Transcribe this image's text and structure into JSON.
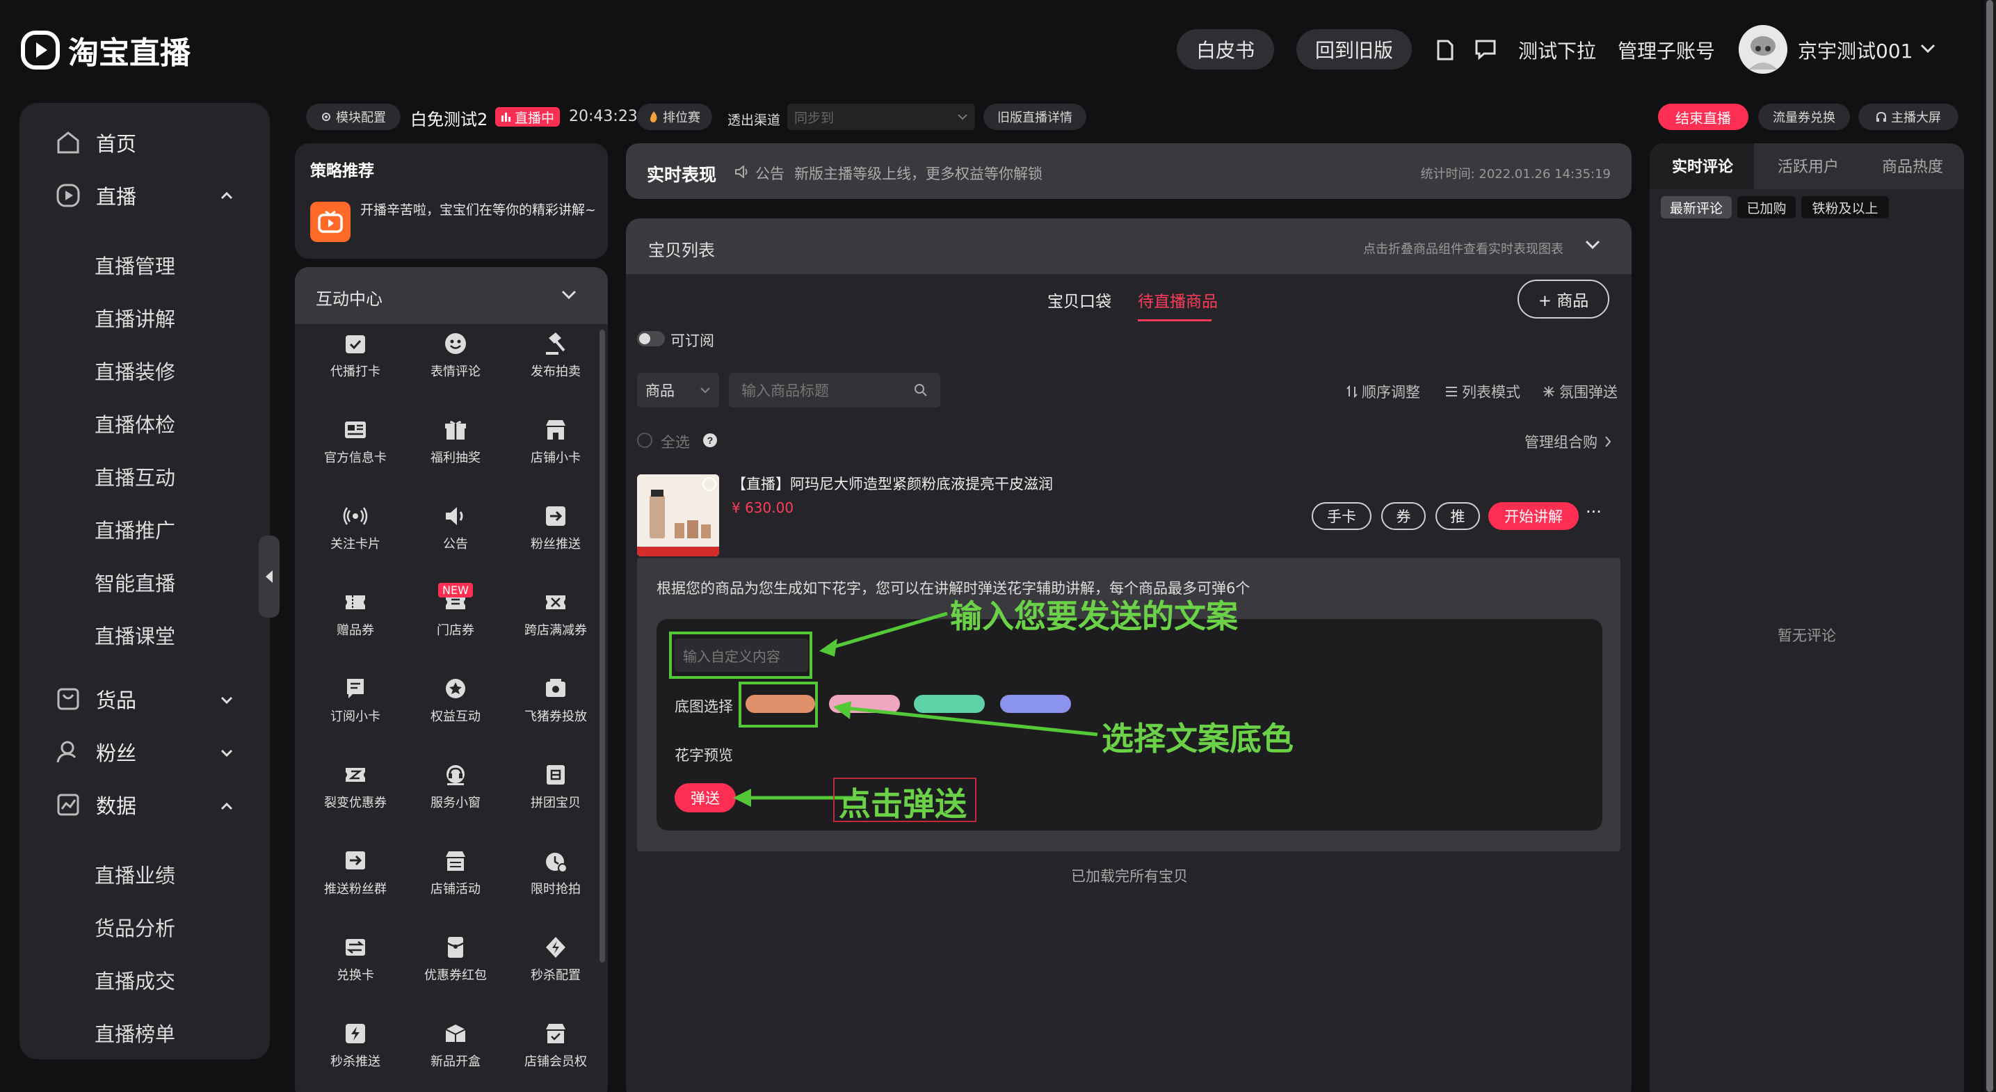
{
  "app": {
    "name": "淘宝直播"
  },
  "header": {
    "whitepaper": "白皮书",
    "back_old": "回到旧版",
    "test_dropdown": "测试下拉",
    "manage_sub": "管理子账号",
    "username": "京宇测试001"
  },
  "sidebar": {
    "home": "首页",
    "live": "直播",
    "live_items": [
      "直播管理",
      "直播讲解",
      "直播装修",
      "直播体检",
      "直播互动",
      "直播推广",
      "智能直播",
      "直播课堂"
    ],
    "goods": "货品",
    "fans": "粉丝",
    "data": "数据",
    "data_items": [
      "直播业绩",
      "货品分析",
      "直播成交",
      "直播榜单"
    ]
  },
  "status_bar": {
    "module_config": "模块配置",
    "room_name": "白免测试2",
    "live_badge": "直播中",
    "time": "20:43:23",
    "ranking": "排位赛",
    "channel_label": "透出渠道",
    "channel_placeholder": "同步到",
    "old_detail": "旧版直播详情",
    "end_live": "结束直播",
    "traffic_coupon": "流量券兑换",
    "anchor_screen": "主播大屏"
  },
  "strategy": {
    "title": "策略推荐",
    "text": "开播辛苦啦，宝宝们在等你的精彩讲解~"
  },
  "interaction": {
    "title": "互动中心",
    "new_badge": "NEW",
    "items": [
      {
        "label": "代播打卡",
        "icon": "check-calendar-icon"
      },
      {
        "label": "表情评论",
        "icon": "emoji-icon"
      },
      {
        "label": "发布拍卖",
        "icon": "auction-hammer-icon"
      },
      {
        "label": "官方信息卡",
        "icon": "info-card-icon"
      },
      {
        "label": "福利抽奖",
        "icon": "gift-icon"
      },
      {
        "label": "店铺小卡",
        "icon": "shop-icon"
      },
      {
        "label": "关注卡片",
        "icon": "broadcast-icon"
      },
      {
        "label": "公告",
        "icon": "speaker-icon"
      },
      {
        "label": "粉丝推送",
        "icon": "push-icon"
      },
      {
        "label": "赠品券",
        "icon": "coupon-icon"
      },
      {
        "label": "门店券",
        "icon": "store-coupon-icon"
      },
      {
        "label": "跨店满减券",
        "icon": "cross-store-coupon-icon"
      },
      {
        "label": "订阅小卡",
        "icon": "subscribe-card-icon"
      },
      {
        "label": "权益互动",
        "icon": "badge-icon"
      },
      {
        "label": "飞猪券投放",
        "icon": "flight-coupon-icon"
      },
      {
        "label": "裂变优惠券",
        "icon": "split-coupon-icon"
      },
      {
        "label": "服务小窗",
        "icon": "service-icon"
      },
      {
        "label": "拼团宝贝",
        "icon": "group-buy-icon"
      },
      {
        "label": "推送粉丝群",
        "icon": "fan-group-icon"
      },
      {
        "label": "店铺活动",
        "icon": "shop-activity-icon"
      },
      {
        "label": "限时抢拍",
        "icon": "timer-icon"
      },
      {
        "label": "兑换卡",
        "icon": "exchange-card-icon"
      },
      {
        "label": "优惠券红包",
        "icon": "red-packet-icon"
      },
      {
        "label": "秒杀配置",
        "icon": "flash-icon"
      },
      {
        "label": "秒杀推送",
        "icon": "flash-push-icon"
      },
      {
        "label": "新品开盒",
        "icon": "box-icon"
      },
      {
        "label": "店铺会员权",
        "icon": "member-icon"
      }
    ]
  },
  "realtime": {
    "title": "实时表现",
    "notice_label": "公告",
    "notice_text": "新版主播等级上线，更多权益等你解锁",
    "stat_time": "统计时间: 2022.01.26 14:35:19"
  },
  "goods_list": {
    "title": "宝贝列表",
    "hint": "点击折叠商品组件查看实时表现图表",
    "tab_bag": "宝贝口袋",
    "tab_pending": "待直播商品",
    "add_goods": "+ 商品",
    "subscribable": "可订阅",
    "filter_select": "商品",
    "search_placeholder": "输入商品标题",
    "order_adjust": "顺序调整",
    "list_mode": "列表模式",
    "atmosphere": "氛围弹送",
    "select_all": "全选",
    "manage_combo": "管理组合购",
    "product": {
      "title": "【直播】阿玛尼大师造型紧颜粉底液提亮干皮滋润",
      "price": "¥ 630.00",
      "hand_card": "手卡",
      "coupon": "券",
      "push": "推",
      "start_explain": "开始讲解",
      "more": "···"
    },
    "flower_text": {
      "tip": "根据您的商品为您生成如下花字，您可以在讲解时弹送花字辅助讲解，每个商品最多可弹6个",
      "input_placeholder": "输入自定义内容",
      "bg_label": "底图选择",
      "preview_label": "花字预览",
      "send": "弹送",
      "swatch_colors": [
        "#e0906a",
        "#f0a6c0",
        "#5fd1a6",
        "#8a94ef"
      ]
    },
    "loaded_all": "已加载完所有宝贝"
  },
  "annotations": {
    "input_text": "输入您要发送的文案",
    "choose_bg": "选择文案底色",
    "click_send": "点击弹送"
  },
  "comments": {
    "tab_realtime": "实时评论",
    "tab_active": "活跃用户",
    "tab_heat": "商品热度",
    "filter_latest": "最新评论",
    "filter_added": "已加购",
    "filter_iron": "铁粉及以上",
    "empty": "暂无评论"
  },
  "colors": {
    "accent": "#ff2f54",
    "annotation": "#55c837",
    "panel": "#252529"
  }
}
